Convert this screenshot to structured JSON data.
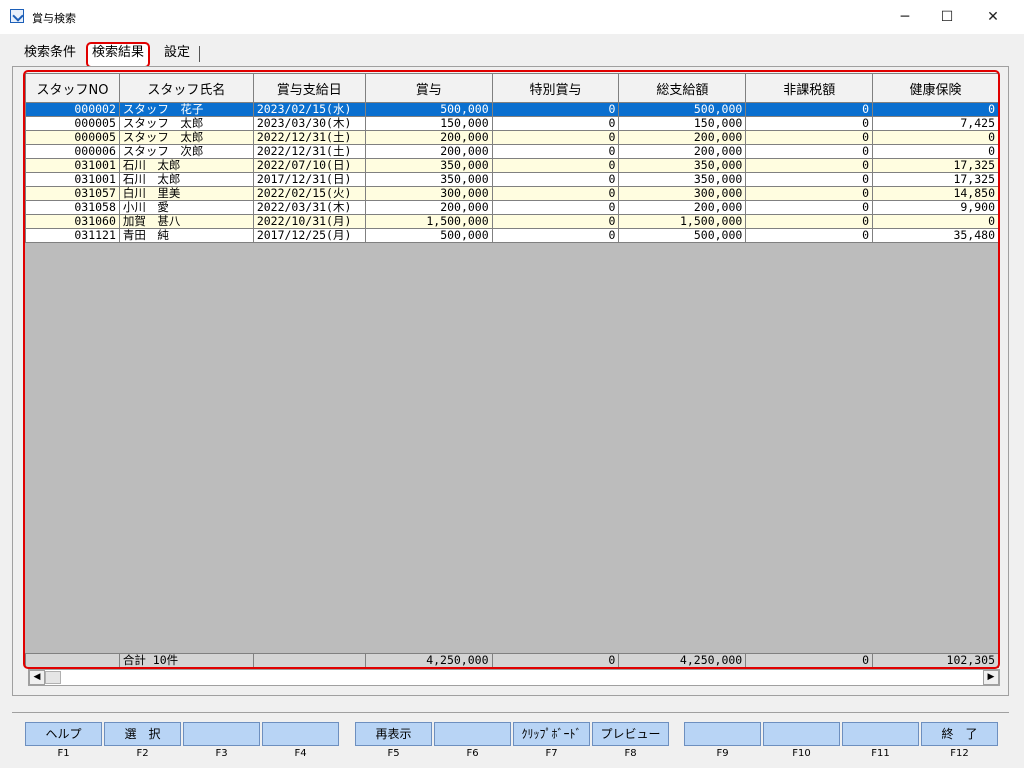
{
  "window": {
    "title": "賞与検索",
    "minimize": "─",
    "maximize": "☐",
    "close": "✕"
  },
  "tabs": [
    {
      "label": "検索条件",
      "active": false
    },
    {
      "label": "検索結果",
      "active": true
    },
    {
      "label": "設定",
      "active": false
    }
  ],
  "grid": {
    "columns": [
      "スタッフNO",
      "スタッフ氏名",
      "賞与支給日",
      "賞与",
      "特別賞与",
      "総支給額",
      "非課税額",
      "健康保険"
    ],
    "rows": [
      {
        "no": "000002",
        "name": "スタッフ　花子",
        "date": "2023/02/15(水)",
        "bonus": "500,000",
        "special": "0",
        "total": "500,000",
        "nontax": "0",
        "health": "0",
        "selected": true
      },
      {
        "no": "000005",
        "name": "スタッフ　太郎",
        "date": "2023/03/30(木)",
        "bonus": "150,000",
        "special": "0",
        "total": "150,000",
        "nontax": "0",
        "health": "7,425"
      },
      {
        "no": "000005",
        "name": "スタッフ　太郎",
        "date": "2022/12/31(土)",
        "bonus": "200,000",
        "special": "0",
        "total": "200,000",
        "nontax": "0",
        "health": "0"
      },
      {
        "no": "000006",
        "name": "スタッフ　次郎",
        "date": "2022/12/31(土)",
        "bonus": "200,000",
        "special": "0",
        "total": "200,000",
        "nontax": "0",
        "health": "0"
      },
      {
        "no": "031001",
        "name": "石川　太郎",
        "date": "2022/07/10(日)",
        "bonus": "350,000",
        "special": "0",
        "total": "350,000",
        "nontax": "0",
        "health": "17,325"
      },
      {
        "no": "031001",
        "name": "石川　太郎",
        "date": "2017/12/31(日)",
        "bonus": "350,000",
        "special": "0",
        "total": "350,000",
        "nontax": "0",
        "health": "17,325"
      },
      {
        "no": "031057",
        "name": "白川　里美",
        "date": "2022/02/15(火)",
        "bonus": "300,000",
        "special": "0",
        "total": "300,000",
        "nontax": "0",
        "health": "14,850"
      },
      {
        "no": "031058",
        "name": "小川　愛",
        "date": "2022/03/31(木)",
        "bonus": "200,000",
        "special": "0",
        "total": "200,000",
        "nontax": "0",
        "health": "9,900"
      },
      {
        "no": "031060",
        "name": "加賀　甚八",
        "date": "2022/10/31(月)",
        "bonus": "1,500,000",
        "special": "0",
        "total": "1,500,000",
        "nontax": "0",
        "health": "0"
      },
      {
        "no": "031121",
        "name": "青田　純",
        "date": "2017/12/25(月)",
        "bonus": "500,000",
        "special": "0",
        "total": "500,000",
        "nontax": "0",
        "health": "35,480"
      }
    ],
    "totals": {
      "label": "合計 10件",
      "bonus": "4,250,000",
      "special": "0",
      "total": "4,250,000",
      "nontax": "0",
      "health": "102,305"
    }
  },
  "scrollbar": {
    "left_arrow": "◀",
    "right_arrow": "▶"
  },
  "fkeys": [
    {
      "key": "F1",
      "label": "ヘルプ"
    },
    {
      "key": "F2",
      "label": "選　択"
    },
    {
      "key": "F3",
      "label": ""
    },
    {
      "key": "F4",
      "label": ""
    },
    {
      "key": "F5",
      "label": "再表示"
    },
    {
      "key": "F6",
      "label": ""
    },
    {
      "key": "F7",
      "label": "ｸﾘｯﾌﾟﾎﾞｰﾄﾞ"
    },
    {
      "key": "F8",
      "label": "プレビュー"
    },
    {
      "key": "F9",
      "label": ""
    },
    {
      "key": "F10",
      "label": ""
    },
    {
      "key": "F11",
      "label": ""
    },
    {
      "key": "F12",
      "label": "終　了"
    }
  ],
  "colors": {
    "selected_row": "#0a6fcf",
    "odd_row": "#fffde0",
    "fkey_bg": "#b8d4f5",
    "highlight_outline": "#e00000"
  }
}
